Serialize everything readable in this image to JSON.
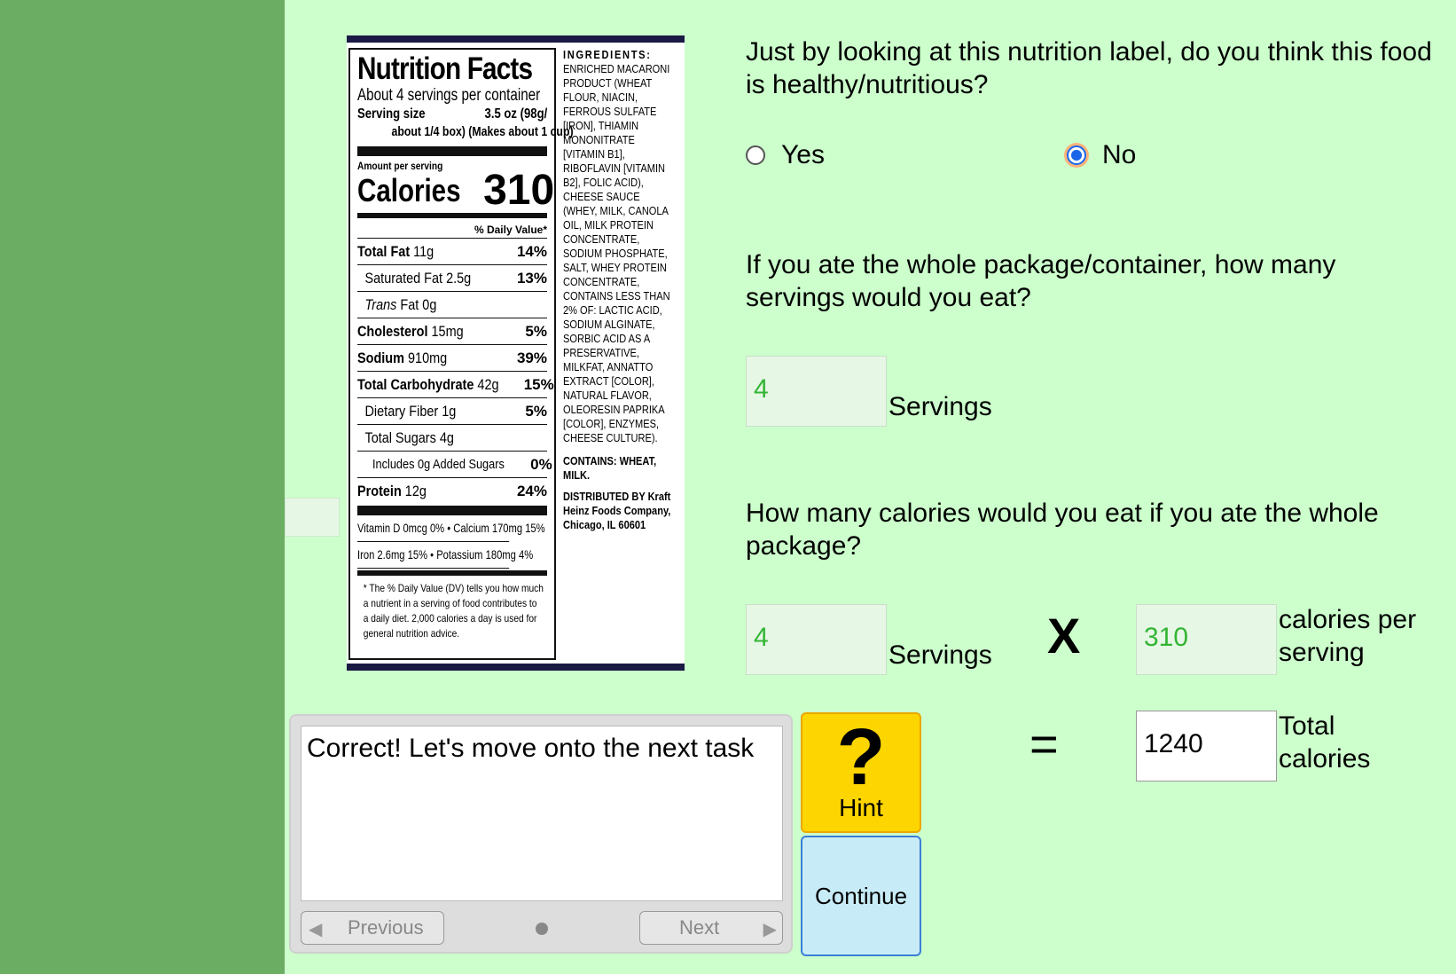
{
  "label": {
    "title": "Nutrition Facts",
    "servings_per_container": "About 4 servings per container",
    "serving_size_label": "Serving size",
    "serving_size_value": "3.5 oz (98g/",
    "serving_size_detail": "about 1/4 box) (Makes about 1 cup)",
    "amount_per_serving": "Amount per serving",
    "calories_label": "Calories",
    "calories_value": "310",
    "daily_value_header": "% Daily Value*",
    "rows": [
      {
        "name": "Total Fat",
        "amount": "11g",
        "pct": "14%"
      },
      {
        "name": "Saturated Fat",
        "amount": "2.5g",
        "pct": "13%"
      },
      {
        "name": "Trans",
        "amount": "Fat 0g",
        "pct": ""
      },
      {
        "name": "Cholesterol",
        "amount": "15mg",
        "pct": "5%"
      },
      {
        "name": "Sodium",
        "amount": "910mg",
        "pct": "39%"
      },
      {
        "name": "Total Carbohydrate",
        "amount": "42g",
        "pct": "15%"
      },
      {
        "name": "Dietary Fiber",
        "amount": "1g",
        "pct": "5%"
      },
      {
        "name": "Total Sugars",
        "amount": "4g",
        "pct": ""
      },
      {
        "name": "Includes 0g Added Sugars",
        "amount": "",
        "pct": "0%"
      },
      {
        "name": "Protein",
        "amount": "12g",
        "pct": "24%"
      }
    ],
    "vitamins_1": "Vitamin D 0mcg 0% • Calcium 170mg 15%",
    "vitamins_2": "Iron 2.6mg 15% • Potassium 180mg 4%",
    "footnote": "* The % Daily Value (DV) tells you how much a nutrient in a serving of food contributes to a daily diet. 2,000 calories a day is used for general nutrition advice.",
    "ingredients_head": "INGREDIENTS:",
    "ingredients": "ENRICHED MACARONI PRODUCT (WHEAT FLOUR, NIACIN, FERROUS SULFATE [IRON], THIAMIN MONONITRATE [VITAMIN B1], RIBOFLAVIN [VITAMIN B2], FOLIC ACID), CHEESE SAUCE (WHEY, MILK, CANOLA OIL, MILK PROTEIN CONCENTRATE, SODIUM PHOSPHATE, SALT, WHEY PROTEIN CONCENTRATE, CONTAINS LESS THAN 2% OF: LACTIC ACID, SODIUM ALGINATE, SORBIC ACID AS A PRESERVATIVE, MILKFAT, ANNATTO EXTRACT [COLOR], NATURAL FLAVOR, OLEORESIN PAPRIKA [COLOR], ENZYMES, CHEESE CULTURE).",
    "contains": "CONTAINS: WHEAT, MILK.",
    "distributed": "DISTRIBUTED BY Kraft Heinz Foods Company, Chicago, IL 60601"
  },
  "q1": {
    "text": "Just by looking at this nutrition label, do you think this food is healthy/nutritious?",
    "opt_yes": "Yes",
    "opt_no": "No",
    "selected": "No"
  },
  "q2": {
    "text": "If you ate the whole package/container, how many servings would you eat?",
    "servings_value": "4",
    "servings_unit": "Servings"
  },
  "q3": {
    "text": "How many calories would you eat if you ate the whole package?",
    "servings_value": "4",
    "servings_unit": "Servings",
    "times": "X",
    "cal_value": "310",
    "cal_unit": "calories per serving",
    "equals": "=",
    "total_value": "1240",
    "total_unit": "Total calories"
  },
  "feedback": {
    "message": "Correct! Let's move onto the next task",
    "prev_label": "Previous",
    "next_label": "Next"
  },
  "hint": {
    "symbol": "?",
    "label": "Hint"
  },
  "continue_label": "Continue",
  "colors": {
    "sidebar": "#6cad64",
    "background": "#ccffcc",
    "hint": "#fdd500",
    "continue": "#c8ecf7",
    "input_text": "#33b533"
  }
}
